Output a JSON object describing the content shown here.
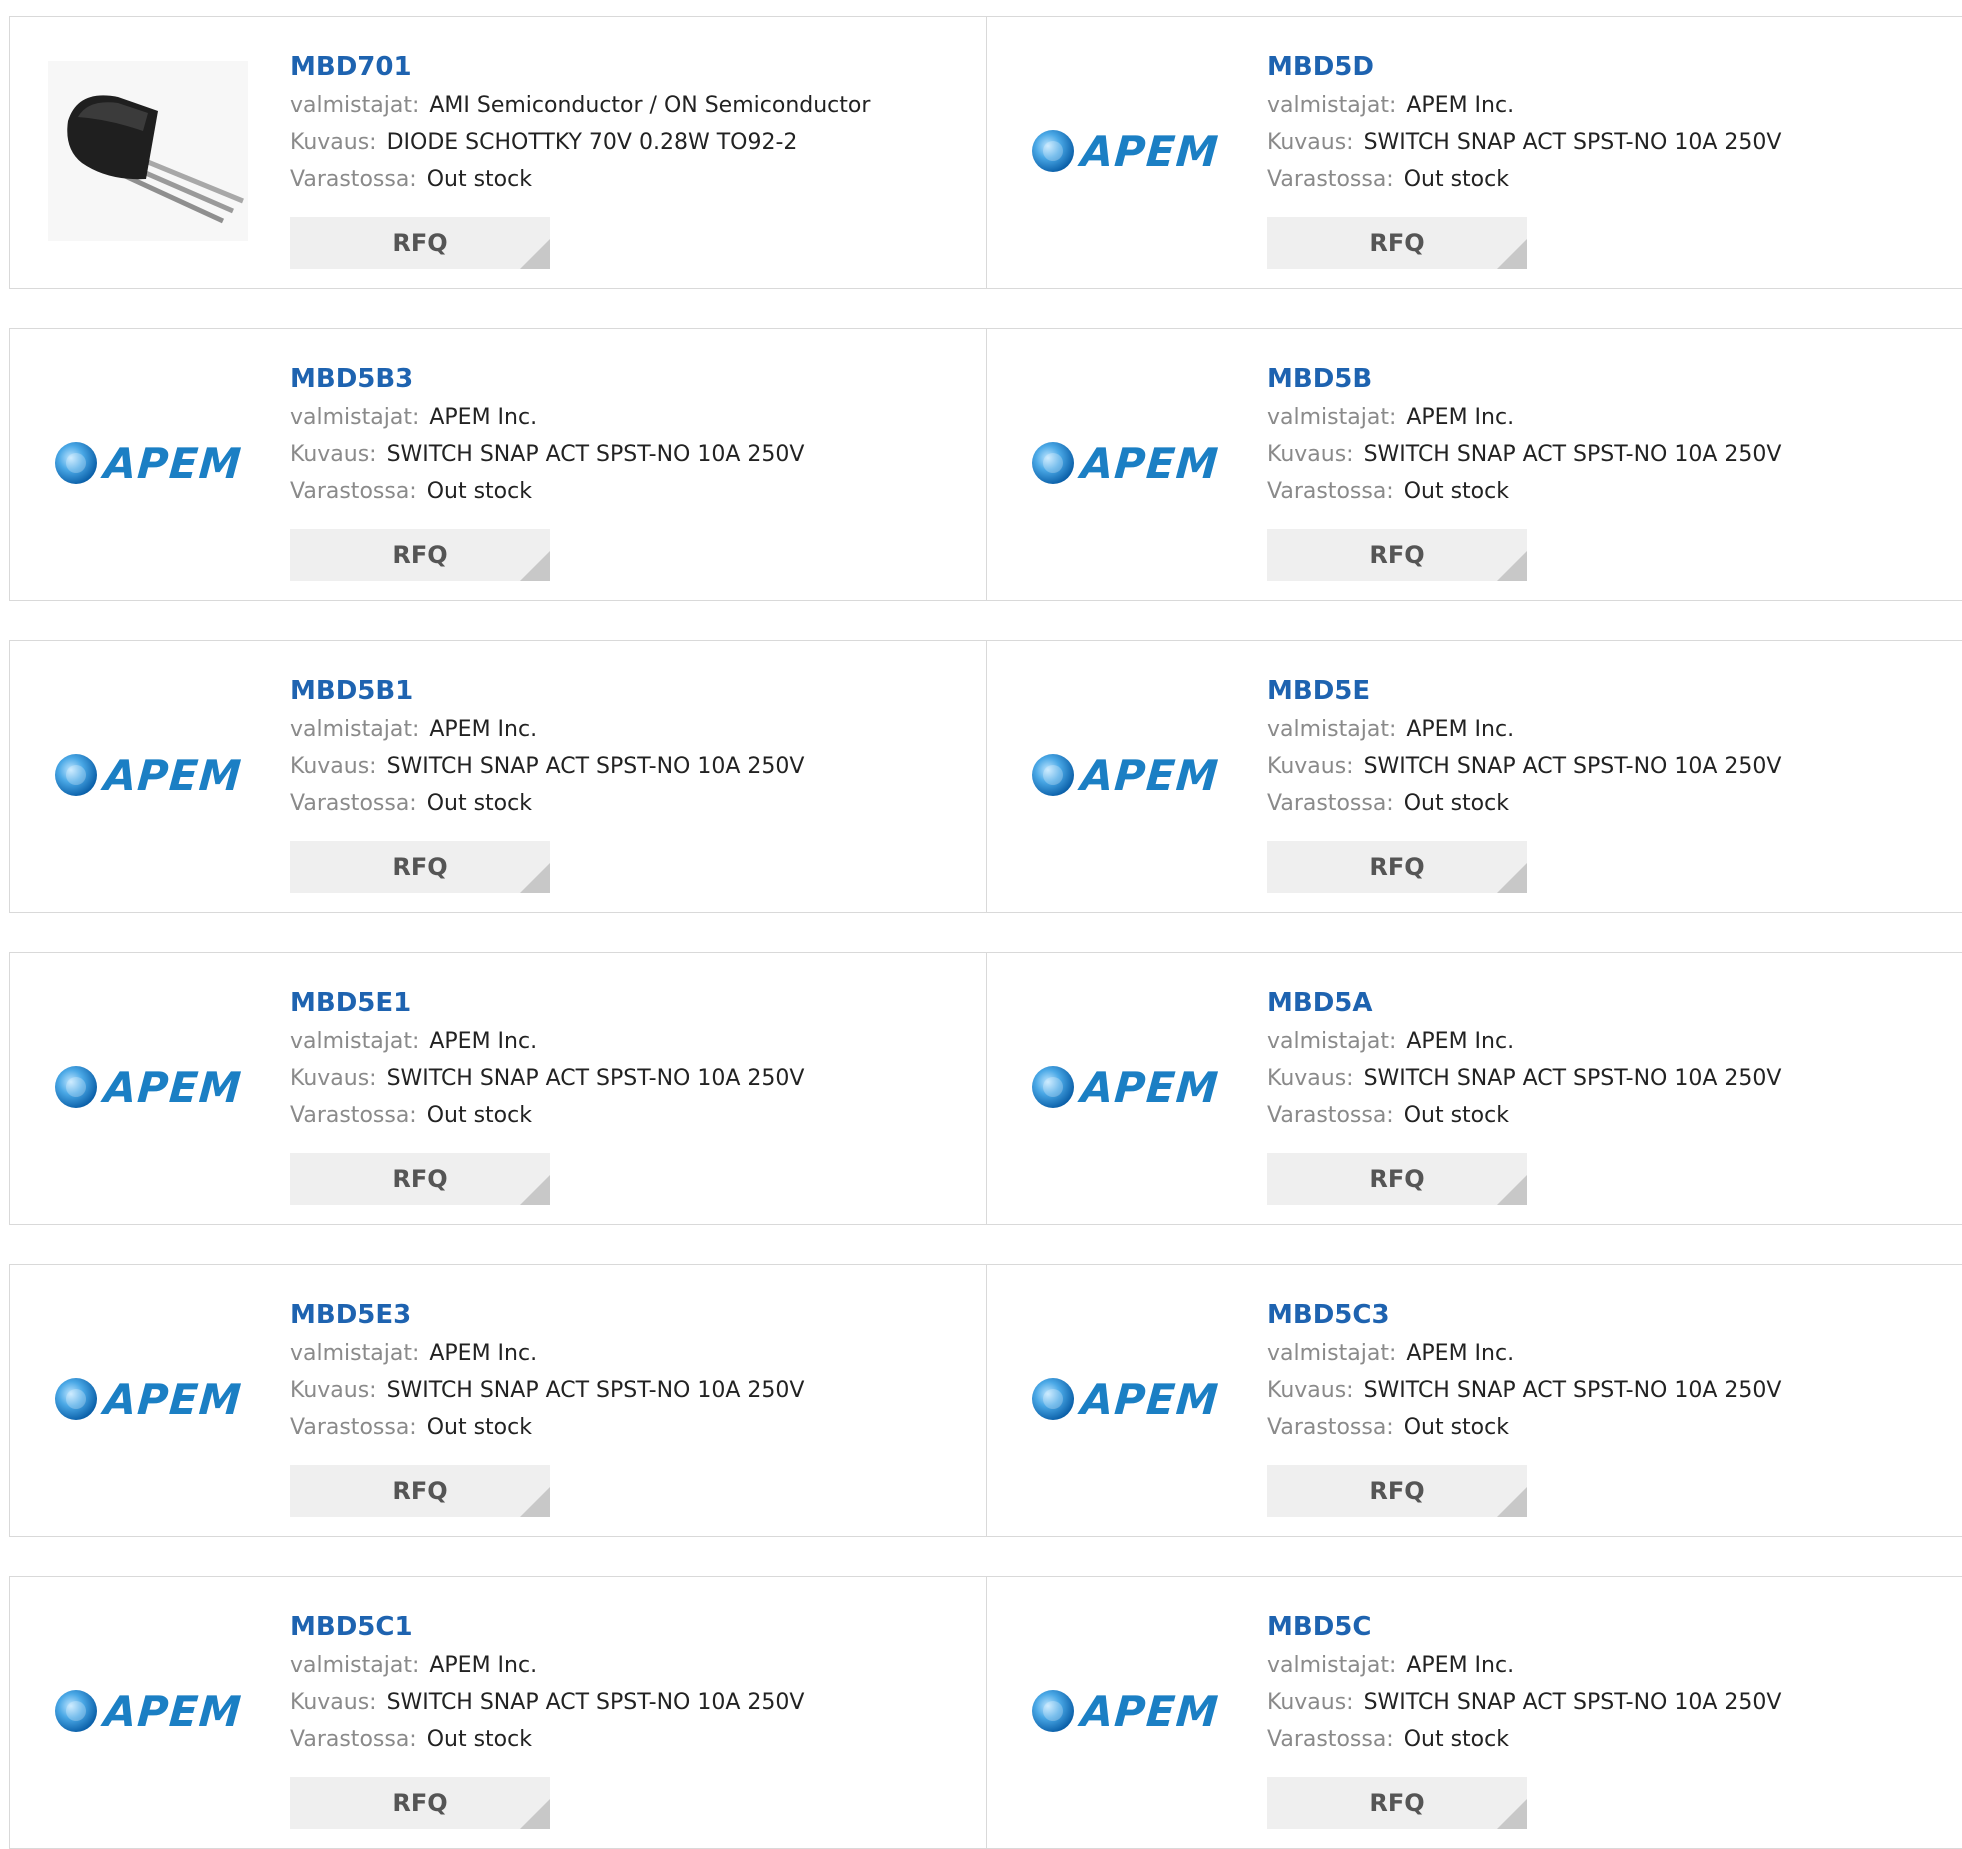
{
  "labels": {
    "manufacturer": "valmistajat:",
    "description": "Kuvaus:",
    "stock": "Varastossa:",
    "rfq": "RFQ"
  },
  "brand": {
    "apem_text": "APEM",
    "apem_color": "#1b7fc4",
    "link_color": "#1e63b0"
  },
  "products": [
    {
      "name": "MBD701",
      "manufacturer": "AMI Semiconductor / ON Semiconductor",
      "description": "DIODE SCHOTTKY 70V 0.28W TO92-2",
      "stock": "Out stock",
      "image": "to92-transistor"
    },
    {
      "name": "MBD5D",
      "manufacturer": "APEM Inc.",
      "description": "SWITCH SNAP ACT SPST-NO 10A 250V",
      "stock": "Out stock",
      "image": "apem-logo"
    },
    {
      "name": "MBD5B3",
      "manufacturer": "APEM Inc.",
      "description": "SWITCH SNAP ACT SPST-NO 10A 250V",
      "stock": "Out stock",
      "image": "apem-logo"
    },
    {
      "name": "MBD5B",
      "manufacturer": "APEM Inc.",
      "description": "SWITCH SNAP ACT SPST-NO 10A 250V",
      "stock": "Out stock",
      "image": "apem-logo"
    },
    {
      "name": "MBD5B1",
      "manufacturer": "APEM Inc.",
      "description": "SWITCH SNAP ACT SPST-NO 10A 250V",
      "stock": "Out stock",
      "image": "apem-logo"
    },
    {
      "name": "MBD5E",
      "manufacturer": "APEM Inc.",
      "description": "SWITCH SNAP ACT SPST-NO 10A 250V",
      "stock": "Out stock",
      "image": "apem-logo"
    },
    {
      "name": "MBD5E1",
      "manufacturer": "APEM Inc.",
      "description": "SWITCH SNAP ACT SPST-NO 10A 250V",
      "stock": "Out stock",
      "image": "apem-logo"
    },
    {
      "name": "MBD5A",
      "manufacturer": "APEM Inc.",
      "description": "SWITCH SNAP ACT SPST-NO 10A 250V",
      "stock": "Out stock",
      "image": "apem-logo"
    },
    {
      "name": "MBD5E3",
      "manufacturer": "APEM Inc.",
      "description": "SWITCH SNAP ACT SPST-NO 10A 250V",
      "stock": "Out stock",
      "image": "apem-logo"
    },
    {
      "name": "MBD5C3",
      "manufacturer": "APEM Inc.",
      "description": "SWITCH SNAP ACT SPST-NO 10A 250V",
      "stock": "Out stock",
      "image": "apem-logo"
    },
    {
      "name": "MBD5C1",
      "manufacturer": "APEM Inc.",
      "description": "SWITCH SNAP ACT SPST-NO 10A 250V",
      "stock": "Out stock",
      "image": "apem-logo"
    },
    {
      "name": "MBD5C",
      "manufacturer": "APEM Inc.",
      "description": "SWITCH SNAP ACT SPST-NO 10A 250V",
      "stock": "Out stock",
      "image": "apem-logo"
    }
  ]
}
